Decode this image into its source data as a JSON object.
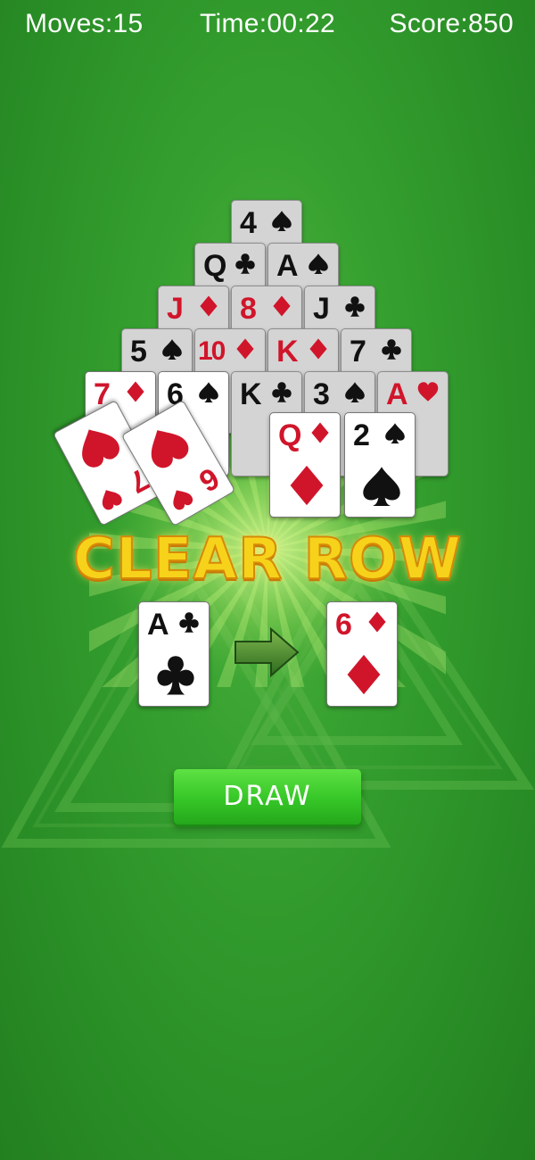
{
  "hud": {
    "moves": "Moves:15",
    "time": "Time:00:22",
    "score": "Score:850"
  },
  "pyramid": [
    {
      "rank": "4",
      "suit": "spade",
      "color": "blk",
      "dim": true
    },
    {
      "rank": "Q",
      "suit": "club",
      "color": "blk",
      "dim": true
    },
    {
      "rank": "A",
      "suit": "spade",
      "color": "blk",
      "dim": true
    },
    {
      "rank": "J",
      "suit": "diamond",
      "color": "red",
      "dim": true
    },
    {
      "rank": "8",
      "suit": "diamond",
      "color": "red",
      "dim": true
    },
    {
      "rank": "J",
      "suit": "club",
      "color": "blk",
      "dim": true
    },
    {
      "rank": "5",
      "suit": "spade",
      "color": "blk",
      "dim": true
    },
    {
      "rank": "10",
      "suit": "diamond",
      "color": "red",
      "dim": true
    },
    {
      "rank": "K",
      "suit": "diamond",
      "color": "red",
      "dim": true
    },
    {
      "rank": "7",
      "suit": "club",
      "color": "blk",
      "dim": true
    },
    {
      "rank": "7",
      "suit": "diamond",
      "color": "red",
      "dim": false
    },
    {
      "rank": "6",
      "suit": "spade",
      "color": "blk",
      "dim": false
    },
    {
      "rank": "K",
      "suit": "club",
      "color": "blk",
      "dim": true
    },
    {
      "rank": "3",
      "suit": "spade",
      "color": "blk",
      "dim": true
    },
    {
      "rank": "A",
      "suit": "heart",
      "color": "red",
      "dim": true
    }
  ],
  "flying_cards": [
    {
      "rank": "7",
      "suit": "heart",
      "color": "red"
    },
    {
      "rank": "6",
      "suit": "heart",
      "color": "red"
    },
    {
      "rank": "Q",
      "suit": "diamond",
      "color": "red"
    },
    {
      "rank": "2",
      "suit": "spade",
      "color": "blk"
    }
  ],
  "banner": "CLEAR ROW",
  "stock_card": {
    "rank": "A",
    "suit": "club",
    "color": "blk"
  },
  "waste_card": {
    "rank": "6",
    "suit": "diamond",
    "color": "red"
  },
  "draw_label": "DRAW",
  "colors": {
    "red_suit": "#d0152b",
    "black_suit": "#111111",
    "felt": "#35a02f",
    "banner": "#f7d21b",
    "button": "#36c627"
  }
}
